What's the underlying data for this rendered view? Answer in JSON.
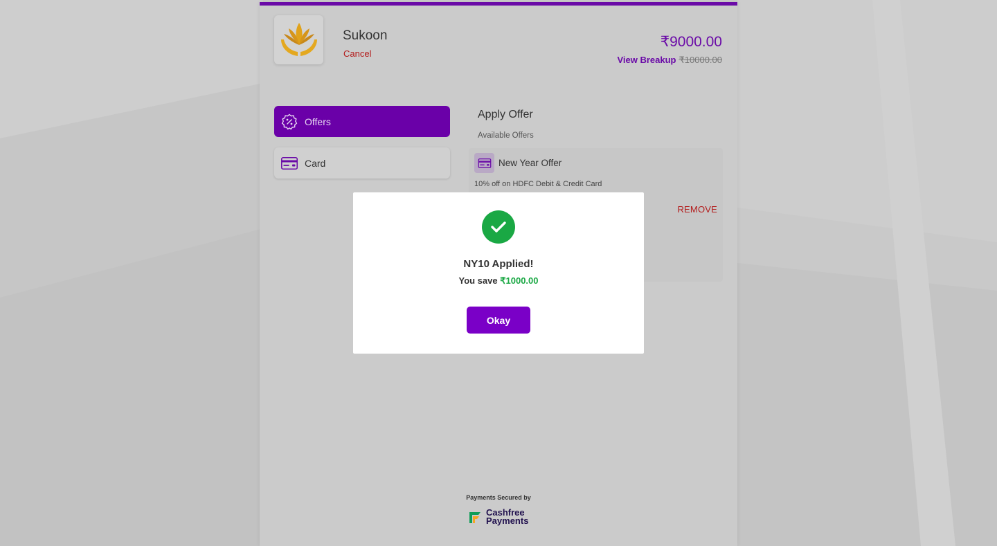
{
  "merchant": {
    "name": "Sukoon",
    "cancel_label": "Cancel"
  },
  "order": {
    "amount": "₹9000.00",
    "view_breakup_label": "View Breakup",
    "original_amount": "₹10000.00"
  },
  "nav": {
    "items": [
      {
        "label": "Offers",
        "icon": "offer-badge-icon",
        "active": true
      },
      {
        "label": "Card",
        "icon": "card-icon",
        "active": false
      }
    ]
  },
  "offers_panel": {
    "title": "Apply Offer",
    "available_label": "Available Offers",
    "offers": [
      {
        "name": "New Year Offer",
        "description": "10% off on HDFC Debit & Credit Card",
        "remove_label": "REMOVE",
        "icon": "card-icon"
      }
    ]
  },
  "modal": {
    "icon": "check-icon",
    "title": "NY10 Applied!",
    "save_prefix": "You save",
    "save_amount": "₹1000.00",
    "ok_label": "Okay"
  },
  "footer": {
    "secured_label": "Payments Secured by",
    "brand_line1": "Cashfree",
    "brand_line2": "Payments"
  },
  "colors": {
    "accent": "#6a0aa7",
    "success": "#1aa844",
    "danger": "#b31b1b"
  }
}
